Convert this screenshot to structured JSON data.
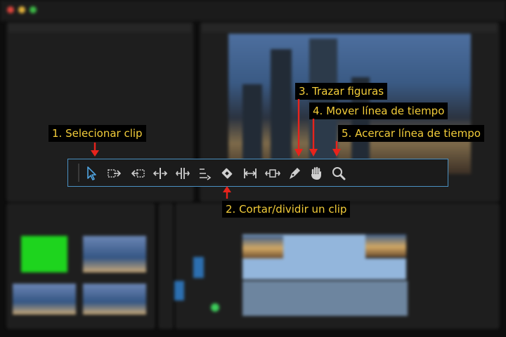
{
  "labels": {
    "select": "1. Selecionar clip",
    "razor": "2. Cortar/dividir un clip",
    "pen": "3. Trazar figuras",
    "hand": "4. Mover línea de tiempo",
    "zoom": "5. Acercar línea de tiempo"
  },
  "tools": [
    {
      "icon": "selection-arrow-icon"
    },
    {
      "icon": "track-select-forward-icon"
    },
    {
      "icon": "track-select-backward-icon"
    },
    {
      "icon": "ripple-edit-icon"
    },
    {
      "icon": "rolling-edit-icon"
    },
    {
      "icon": "rate-stretch-icon"
    },
    {
      "icon": "razor-icon"
    },
    {
      "icon": "slip-icon"
    },
    {
      "icon": "slide-icon"
    },
    {
      "icon": "pen-icon"
    },
    {
      "icon": "hand-icon"
    },
    {
      "icon": "zoom-icon"
    }
  ],
  "colors": {
    "label_text": "#f3cd3a",
    "label_bg": "#000000",
    "arrow": "#e8231c",
    "toolbar_border": "#4a90c2",
    "selected_tool": "#4fa3e0",
    "tool_icon": "#d0d0d0"
  }
}
